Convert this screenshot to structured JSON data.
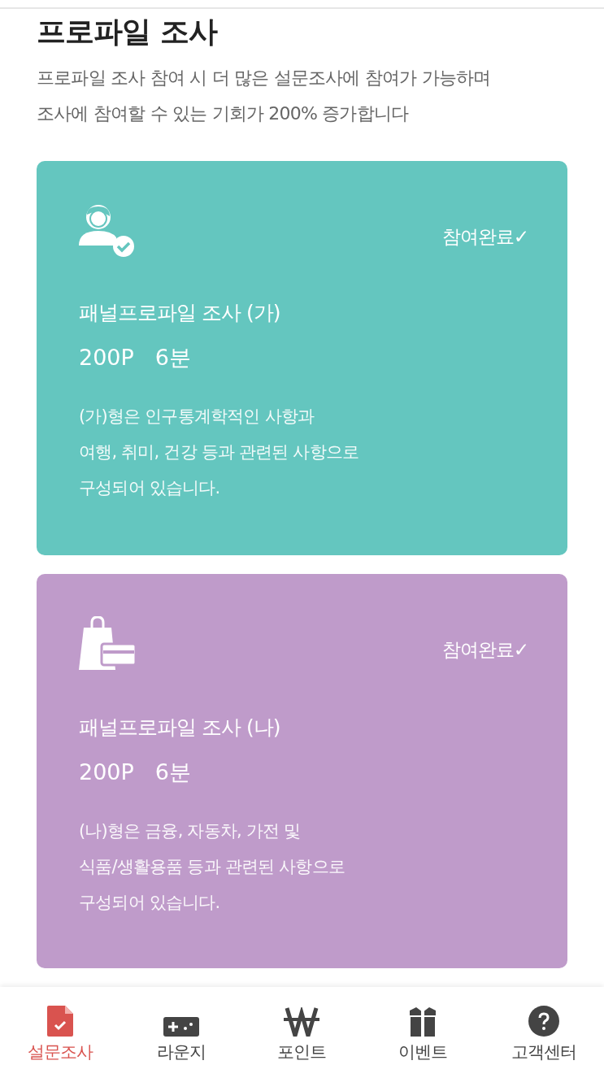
{
  "header": {
    "title": "프로파일 조사",
    "subtitle_lines": [
      "프로파일 조사 참여 시 더 많은 설문조사에 참여가 가능하며",
      "조사에 참여할 수 있는 기회가 200% 증가합니다"
    ]
  },
  "cards": [
    {
      "kind": "person",
      "color": "#64c6bf",
      "completed": true,
      "status": "참여완료✓",
      "title": "패널프로파일 조사 (가)",
      "points": "200P",
      "time": "6분",
      "description_lines": [
        "(가)형은 인구통계학적인 사항과",
        "여행, 취미, 건강 등과 관련된 사항으로",
        "구성되어 있습니다."
      ]
    },
    {
      "kind": "shopping",
      "color": "#bf9bca",
      "completed": true,
      "status": "참여완료✓",
      "title": "패널프로파일 조사 (나)",
      "points": "200P",
      "time": "6분",
      "description_lines": [
        "(나)형은 금융, 자동차, 가전 및",
        "식품/생활용품 등과 관련된 사항으로",
        "구성되어 있습니다."
      ]
    }
  ],
  "bottom_nav": [
    {
      "kind": "survey",
      "label": "설문조사",
      "selected": true
    },
    {
      "kind": "gamepad",
      "label": "라운지",
      "selected": false
    },
    {
      "kind": "won",
      "label": "포인트",
      "selected": false
    },
    {
      "kind": "gift",
      "label": "이벤트",
      "selected": false
    },
    {
      "kind": "help",
      "label": "고객센터",
      "selected": false
    }
  ]
}
